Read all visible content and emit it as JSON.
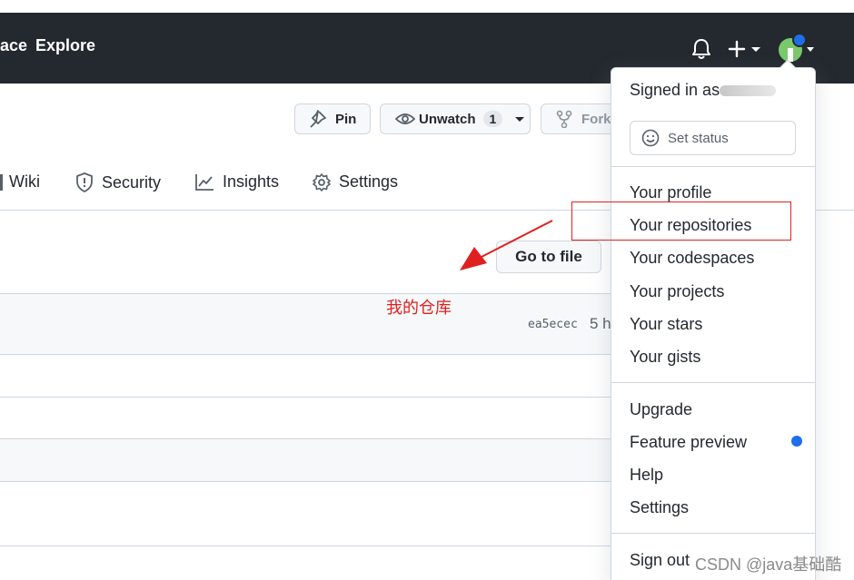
{
  "header": {
    "nav_partial": "ace",
    "explore": "Explore"
  },
  "repo_actions": {
    "pin": "Pin",
    "unwatch": "Unwatch",
    "watch_count": "1",
    "fork": "Fork"
  },
  "tabs": [
    {
      "label": "Wiki"
    },
    {
      "label": "Security",
      "icon": "shield-icon"
    },
    {
      "label": "Insights",
      "icon": "graph-icon"
    },
    {
      "label": "Settings",
      "icon": "gear-icon"
    }
  ],
  "code": {
    "go_to_file": "Go to file",
    "commit_hash": "ea5ecec",
    "commit_time": "5 h"
  },
  "annotation": {
    "label": "我的仓库",
    "color": "#e02020"
  },
  "user_menu": {
    "signed_in": "Signed in as",
    "set_status": "Set status",
    "items_1": [
      "Your profile",
      "Your repositories",
      "Your codespaces",
      "Your projects",
      "Your stars",
      "Your gists"
    ],
    "items_2": [
      "Upgrade",
      "Feature preview",
      "Help",
      "Settings"
    ],
    "sign_out": "Sign out",
    "feature_dot_color": "#1f6feb"
  },
  "watermark": "CSDN @java基础酷",
  "colors": {
    "header_bg": "#24292f",
    "accent": "#1f6feb"
  }
}
